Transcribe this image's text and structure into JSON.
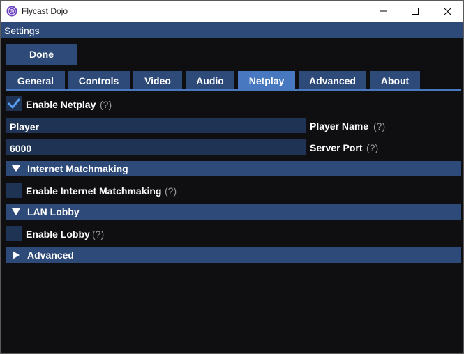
{
  "window": {
    "title": "Flycast Dojo",
    "icon": "flycast-logo-icon",
    "controls": {
      "minimize": "minimize-icon",
      "maximize": "maximize-icon",
      "close": "close-icon"
    }
  },
  "settings": {
    "title": "Settings"
  },
  "done_label": "Done",
  "tabs": [
    {
      "label": "General",
      "active": false
    },
    {
      "label": "Controls",
      "active": false
    },
    {
      "label": "Video",
      "active": false
    },
    {
      "label": "Audio",
      "active": false
    },
    {
      "label": "Netplay",
      "active": true
    },
    {
      "label": "Advanced",
      "active": false
    },
    {
      "label": "About",
      "active": false
    }
  ],
  "netplay": {
    "enable_netplay": {
      "label": "Enable Netplay",
      "checked": true,
      "help": "(?)"
    },
    "player_name": {
      "value": "Player",
      "label": "Player Name",
      "help": "(?)"
    },
    "server_port": {
      "value": "6000",
      "label": "Server Port",
      "help": "(?)"
    },
    "internet_matchmaking": {
      "header": "Internet Matchmaking",
      "expanded": true,
      "enable": {
        "label": "Enable Internet Matchmaking",
        "checked": false,
        "help": "(?)"
      }
    },
    "lan_lobby": {
      "header": "LAN Lobby",
      "expanded": true,
      "enable": {
        "label": "Enable Lobby",
        "checked": false,
        "help": "(?)"
      }
    },
    "advanced": {
      "header": "Advanced",
      "expanded": false
    }
  },
  "colors": {
    "accent": "#2e4a78",
    "accent_active": "#4878c0",
    "field_bg": "#1f3454",
    "check": "#5a9cf0",
    "background": "#0f0f11"
  }
}
